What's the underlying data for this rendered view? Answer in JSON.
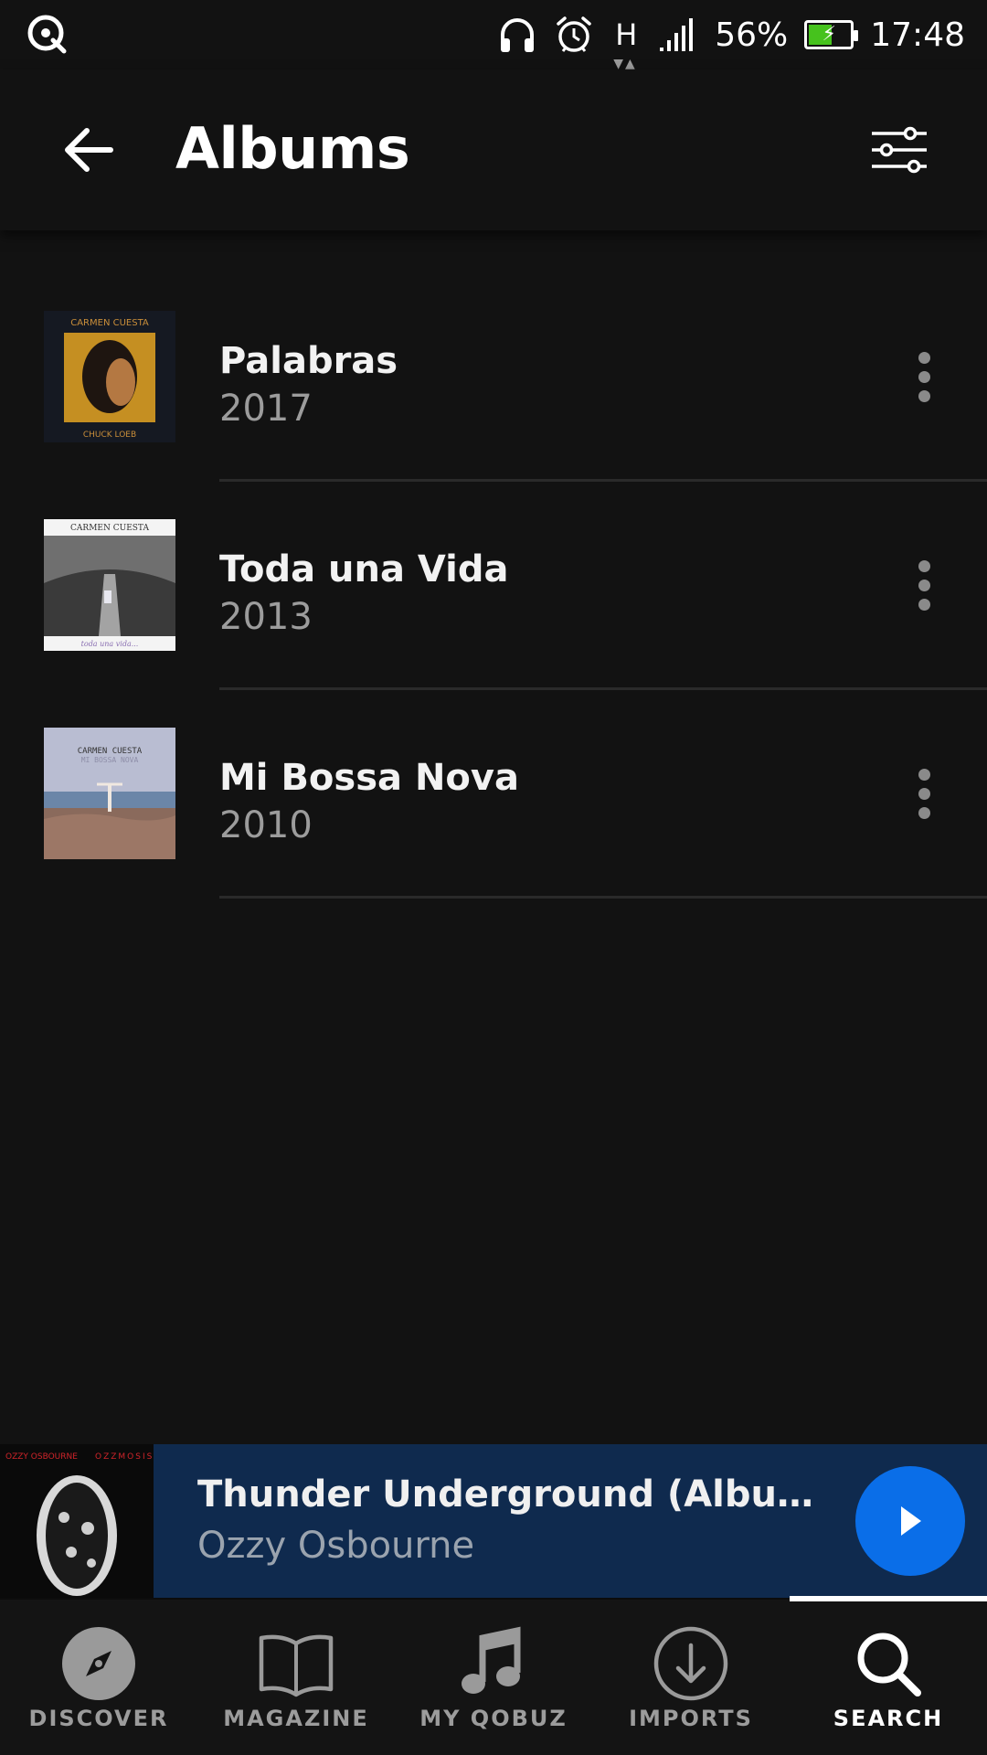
{
  "status_bar": {
    "network_type": "H",
    "battery_percent": "56%",
    "battery_level": 0.56,
    "time": "17:48",
    "icons": [
      "qobuz-app-icon",
      "headphones-icon",
      "alarm-icon",
      "network-h-icon",
      "signal-icon",
      "battery-charging-icon"
    ]
  },
  "header": {
    "title": "Albums",
    "back_icon": "back-arrow-icon",
    "filter_icon": "filter-sliders-icon"
  },
  "albums": [
    {
      "title": "Palabras",
      "year": "2017",
      "cover_text_top": "CARMEN CUESTA",
      "cover_text_bottom": "CHUCK LOEB"
    },
    {
      "title": "Toda una Vida",
      "year": "2013",
      "cover_text_top": "CARMEN CUESTA",
      "cover_text_bottom": "toda una vida..."
    },
    {
      "title": "Mi Bossa Nova",
      "year": "2010",
      "cover_text_top": "CARMEN CUESTA",
      "cover_text_bottom": "MI BOSSA NOVA"
    }
  ],
  "player": {
    "track": "Thunder Underground (Album Versi…",
    "artist": "Ozzy Osbourne",
    "cover_text_left": "OZZY OSBOURNE",
    "cover_text_right": "OZZMOSIS"
  },
  "nav": {
    "items": [
      {
        "label": "DISCOVER",
        "icon": "compass-icon",
        "active": false
      },
      {
        "label": "MAGAZINE",
        "icon": "open-book-icon",
        "active": false
      },
      {
        "label": "MY QOBUZ",
        "icon": "music-note-icon",
        "active": false
      },
      {
        "label": "IMPORTS",
        "icon": "download-circle-icon",
        "active": false
      },
      {
        "label": "SEARCH",
        "icon": "search-icon",
        "active": true
      }
    ]
  },
  "colors": {
    "background": "#121212",
    "player_bg": "#0f2a4e",
    "play_button": "#0a6ee8",
    "battery_fill": "#46c21d"
  }
}
